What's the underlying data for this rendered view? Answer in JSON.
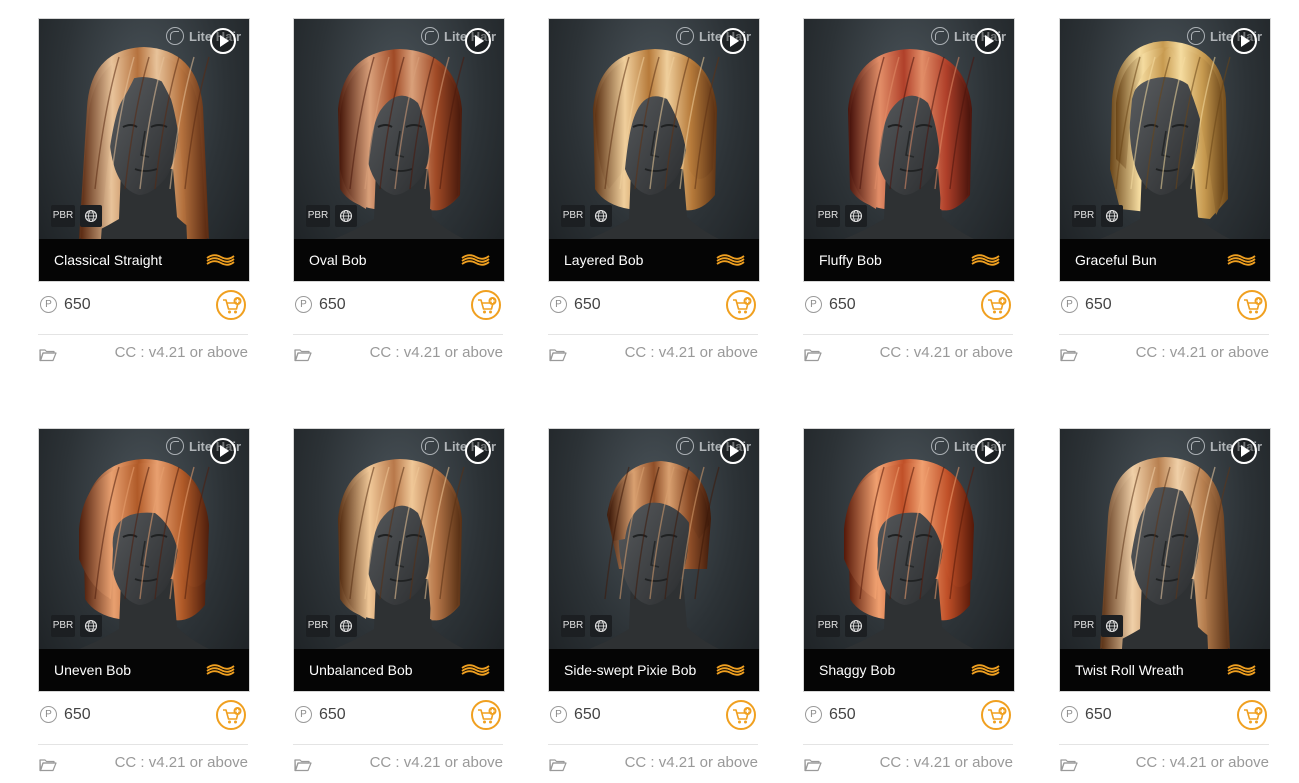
{
  "cards": [
    {
      "name": "Classical Straight",
      "price": "650",
      "compat": "CC : v4.21 or above",
      "hair_light": "#e8c39a",
      "hair_mid": "#b5723e",
      "hair_dark": "#5a2a12",
      "style": "long"
    },
    {
      "name": "Oval Bob",
      "price": "650",
      "compat": "CC : v4.21 or above",
      "hair_light": "#d9a07a",
      "hair_mid": "#a04a26",
      "hair_dark": "#4a1a0c",
      "style": "bob"
    },
    {
      "name": "Layered Bob",
      "price": "650",
      "compat": "CC : v4.21 or above",
      "hair_light": "#f0cf9c",
      "hair_mid": "#b67a3a",
      "hair_dark": "#5c3214",
      "style": "layered"
    },
    {
      "name": "Fluffy Bob",
      "price": "650",
      "compat": "CC : v4.21 or above",
      "hair_light": "#e28e68",
      "hair_mid": "#b0402a",
      "hair_dark": "#4a140c",
      "style": "bob"
    },
    {
      "name": "Graceful Bun",
      "price": "650",
      "compat": "CC : v4.21 or above",
      "hair_light": "#f5dca0",
      "hair_mid": "#c79a50",
      "hair_dark": "#6a4518",
      "style": "bun"
    },
    {
      "name": "Uneven Bob",
      "price": "650",
      "compat": "CC : v4.21 or above",
      "hair_light": "#e8a070",
      "hair_mid": "#b05a28",
      "hair_dark": "#4e1e0c",
      "style": "short"
    },
    {
      "name": "Unbalanced Bob",
      "price": "650",
      "compat": "CC : v4.21 or above",
      "hair_light": "#f0c898",
      "hair_mid": "#b8784a",
      "hair_dark": "#583014",
      "style": "bob"
    },
    {
      "name": "Side-swept Pixie Bob",
      "price": "650",
      "compat": "CC : v4.21 or above",
      "hair_light": "#d9a070",
      "hair_mid": "#8e4e28",
      "hair_dark": "#3e1a0a",
      "style": "pixie"
    },
    {
      "name": "Shaggy Bob",
      "price": "650",
      "compat": "CC : v4.21 or above",
      "hair_light": "#f0a070",
      "hair_mid": "#c05028",
      "hair_dark": "#561808",
      "style": "short"
    },
    {
      "name": "Twist Roll Wreath",
      "price": "650",
      "compat": "CC : v4.21 or above",
      "hair_light": "#f0d0a8",
      "hair_mid": "#b88050",
      "hair_dark": "#5c3418",
      "style": "long"
    }
  ],
  "labels": {
    "brand": "Lite Hair",
    "badge_pbr": "PBR",
    "currency_symbol": "P"
  },
  "colors": {
    "accent": "#f0a020",
    "name_bar": "#050505",
    "price_text": "#444444",
    "meta_text": "#999999"
  },
  "icons": {
    "play": "play-icon",
    "cart": "add-to-cart-icon",
    "folder": "folder-icon",
    "globe": "globe-mesh-icon",
    "wave": "wave-logo-icon",
    "coin": "points-coin-icon"
  }
}
